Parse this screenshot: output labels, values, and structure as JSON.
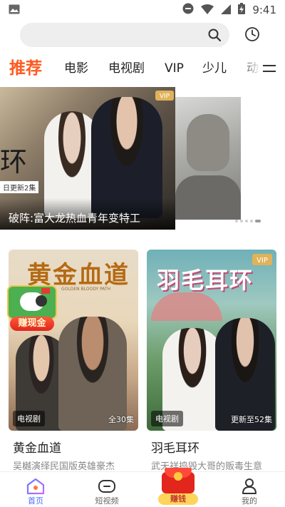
{
  "status_bar": {
    "time": "9:41",
    "icons": [
      "image-icon",
      "do-not-disturb-icon",
      "wifi-icon",
      "signal-icon",
      "battery-charging-icon"
    ]
  },
  "search": {
    "placeholder": "",
    "icons": [
      "search-icon",
      "history-icon"
    ]
  },
  "tabs": [
    {
      "label": "推荐",
      "active": true
    },
    {
      "label": "电影",
      "active": false
    },
    {
      "label": "电视剧",
      "active": false
    },
    {
      "label": "VIP",
      "active": false
    },
    {
      "label": "少儿",
      "active": false
    },
    {
      "label": "动",
      "active": false
    }
  ],
  "banner": {
    "caption": "破阵:富大龙热血青年变特工",
    "poster_char": "环",
    "update_tag": "日更新2集",
    "vip_label": "VIP"
  },
  "cards": [
    {
      "poster_title": "黄金血道",
      "poster_subtitle": "GOLDEN BLOODY PATH",
      "genre": "电视剧",
      "episodes": "全30集",
      "title": "黄金血道",
      "desc": "吴樾演绎民国版英雄豪杰"
    },
    {
      "poster_title": "羽毛耳环",
      "vip_label": "VIP",
      "genre": "电视剧",
      "episodes": "更新至52集",
      "title": "羽毛耳环",
      "desc": "武天祥捣毁大哥的贩毒生意"
    }
  ],
  "earn_float": {
    "label": "赚现金"
  },
  "bottom_nav": [
    {
      "label": "首页",
      "icon": "home-icon",
      "active": true
    },
    {
      "label": "短视频",
      "icon": "short-video-icon",
      "active": false
    },
    {
      "label": "赚钱",
      "icon": "red-envelope-icon",
      "active": false
    },
    {
      "label": "我的",
      "icon": "profile-icon",
      "active": false
    }
  ],
  "colors": {
    "accent": "#ff5a1f",
    "nav_active": "#4a6cf7",
    "vip_gold": "#e0b25a"
  }
}
